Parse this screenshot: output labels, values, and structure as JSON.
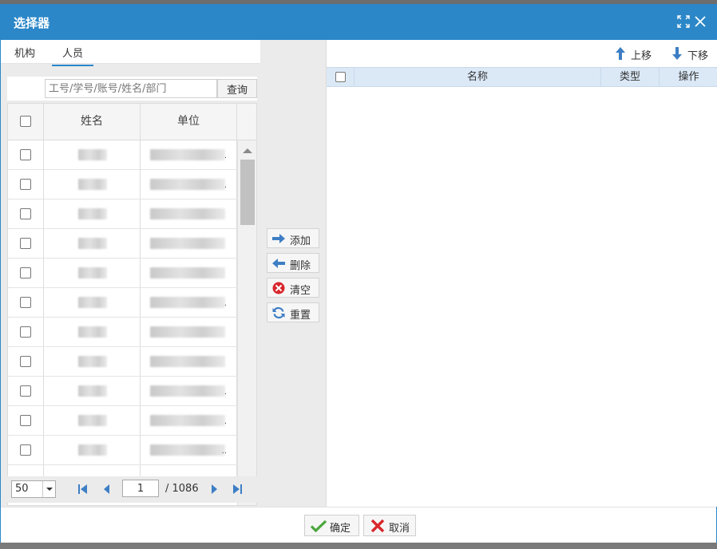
{
  "dialog": {
    "title": "选择器",
    "icons": {
      "maximize": "expand-icon",
      "close": "close-icon"
    }
  },
  "tabs": [
    {
      "label": "机构",
      "active": false
    },
    {
      "label": "人员",
      "active": true
    }
  ],
  "search": {
    "placeholder": "工号/学号/账号/姓名/部门",
    "button_label": "查询"
  },
  "left_grid": {
    "columns": [
      "姓名",
      "单位"
    ],
    "row_count_visible": 11,
    "rows_content": "blurred"
  },
  "pager": {
    "page_size": "50",
    "current_page": "1",
    "total_pages": "/ 1086"
  },
  "actions": {
    "add": "添加",
    "remove": "删除",
    "clear": "清空",
    "reset": "重置"
  },
  "right_panel": {
    "move_up": "上移",
    "move_down": "下移",
    "columns": [
      "名称",
      "类型",
      "操作"
    ]
  },
  "footer": {
    "ok": "确定",
    "cancel": "取消"
  },
  "colors": {
    "titlebar": "#2b87c8",
    "header_blue": "#dbe9f7",
    "panel_gray": "#ebebeb",
    "icon_blue": "#3d7ec4",
    "ok_green": "#4aa63c",
    "cancel_red": "#d9262c"
  }
}
